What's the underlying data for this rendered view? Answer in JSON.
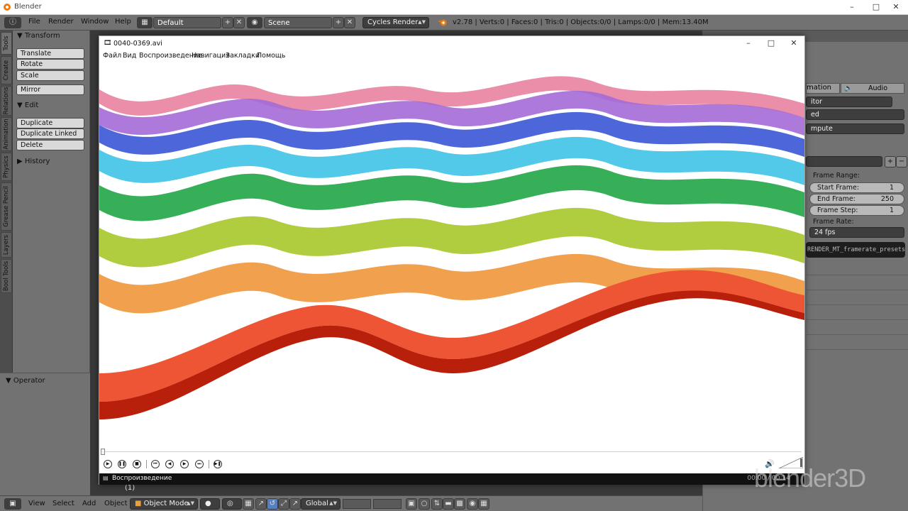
{
  "window": {
    "title": "Blender"
  },
  "info_header": {
    "menus": [
      "File",
      "Render",
      "Window",
      "Help"
    ],
    "layout": "Default",
    "scene": "Scene",
    "engine": "Cycles Render",
    "stats": "v2.78 | Verts:0 | Faces:0 | Tris:0 | Objects:0/0 | Lamps:0/0 | Mem:13.40M"
  },
  "tool_tabs": [
    "Tools",
    "Create",
    "Relations",
    "Animation",
    "Physics",
    "Grease Pencil",
    "Layers",
    "Bool Tools"
  ],
  "toolshelf": {
    "transform_label": "Transform",
    "transform_buttons": [
      "Translate",
      "Rotate",
      "Scale"
    ],
    "mirror": "Mirror",
    "edit_label": "Edit",
    "edit_buttons": [
      "Duplicate",
      "Duplicate Linked",
      "Delete"
    ],
    "history_label": "History",
    "operator_label": "Operator"
  },
  "properties": {
    "tab_animation": "mation",
    "tab_audio": "Audio",
    "editor": "itor",
    "ed": "ed",
    "compute": "mpute",
    "frame_range_label": "Frame Range:",
    "start_frame": {
      "label": "Start Frame:",
      "value": "1"
    },
    "end_frame": {
      "label": "End Frame:",
      "value": "250"
    },
    "frame_step": {
      "label": "Frame Step:",
      "value": "1"
    },
    "frame_rate_label": "Frame Rate:",
    "frame_rate": "24 fps",
    "tooltip": "RENDER_MT_framerate_presets"
  },
  "bottom_header": {
    "menus": [
      "View",
      "Select",
      "Add",
      "Object"
    ],
    "mode": "Object Mode",
    "orientation": "Global",
    "frame": "(1)"
  },
  "player": {
    "title": "0040-0369.avi",
    "menus": [
      "Файл",
      "Вид",
      "Воспроизведение",
      "Навигация",
      "Закладки",
      "Помощь"
    ],
    "status": "Воспроизведение",
    "time": "00:00 / 00:14"
  },
  "watermark": "blender3D"
}
